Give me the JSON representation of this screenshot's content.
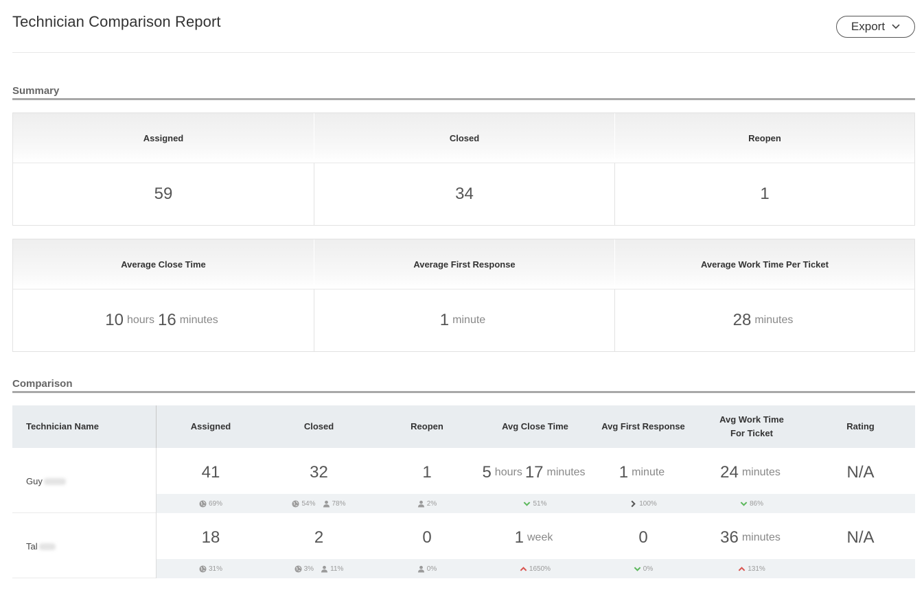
{
  "header": {
    "title": "Technician Comparison Report",
    "export_label": "Export"
  },
  "summary": {
    "title": "Summary",
    "row1": [
      {
        "label": "Assigned",
        "value": "59"
      },
      {
        "label": "Closed",
        "value": "34"
      },
      {
        "label": "Reopen",
        "value": "1"
      }
    ],
    "row2": [
      {
        "label": "Average Close Time",
        "num1": "10",
        "unit1": "hours",
        "num2": "16",
        "unit2": "minutes"
      },
      {
        "label": "Average First Response",
        "num1": "1",
        "unit1": "minute"
      },
      {
        "label": "Average Work Time Per Ticket",
        "num1": "28",
        "unit1": "minutes"
      }
    ]
  },
  "comparison": {
    "title": "Comparison",
    "columns": [
      "Technician Name",
      "Assigned",
      "Closed",
      "Reopen",
      "Avg Close Time",
      "Avg First Response",
      "Avg Work Time For Ticket",
      "Rating"
    ],
    "rows": [
      {
        "name": "Guy",
        "assigned": "41",
        "closed": "32",
        "reopen": "1",
        "close_num1": "5",
        "close_unit1": "hours",
        "close_num2": "17",
        "close_unit2": "minutes",
        "first_num": "1",
        "first_unit": "minute",
        "work_num": "24",
        "work_unit": "minutes",
        "rating": "N/A",
        "assigned_pct": "69%",
        "closed_pct_global": "54%",
        "closed_pct_user": "78%",
        "reopen_pct": "2%",
        "close_pct": "51%",
        "first_pct": "100%",
        "work_pct": "86%"
      },
      {
        "name": "Tal",
        "assigned": "18",
        "closed": "2",
        "reopen": "0",
        "close_num1": "1",
        "close_unit1": "week",
        "first_num": "0",
        "work_num": "36",
        "work_unit": "minutes",
        "rating": "N/A",
        "assigned_pct": "31%",
        "closed_pct_global": "3%",
        "closed_pct_user": "11%",
        "reopen_pct": "0%",
        "close_pct": "1650%",
        "first_pct": "0%",
        "work_pct": "131%"
      }
    ]
  },
  "colors": {
    "trend_good": "#5cb85c",
    "trend_bad": "#d9534f",
    "trend_neutral": "#555555",
    "icon_grey": "#9a9a9a"
  }
}
